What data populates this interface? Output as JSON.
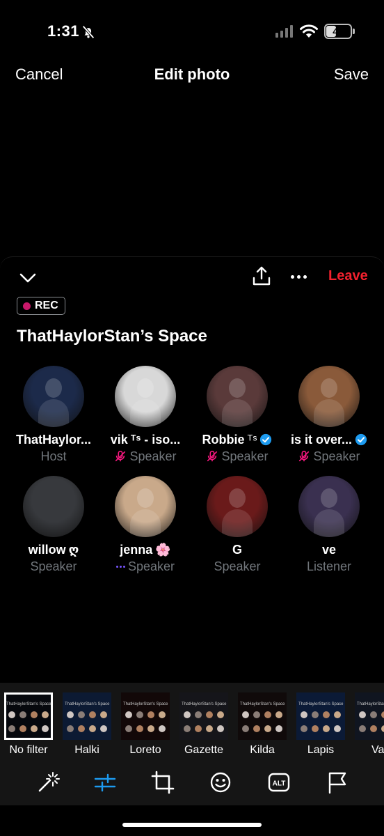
{
  "status_bar": {
    "time": "1:31",
    "battery": "42",
    "battery_level": 0.42
  },
  "nav": {
    "cancel": "Cancel",
    "title": "Edit photo",
    "save": "Save"
  },
  "space": {
    "leave": "Leave",
    "rec": "REC",
    "title": "ThatHaylorStan’s Space",
    "participants": [
      {
        "name": "ThatHaylor...",
        "role": "Host",
        "avatar_color": "#1c2a4a"
      },
      {
        "name": "vik",
        "name_suffix": "ᵀˢ - iso...",
        "role": "Speaker",
        "muted": true,
        "avatar_color": "#d8d8d8"
      },
      {
        "name": "Robbie",
        "name_suffix": "ᵀˢ",
        "role": "Speaker",
        "muted": true,
        "verified": true,
        "avatar_color": "#5a3a3a"
      },
      {
        "name": "is it over...",
        "role": "Speaker",
        "muted": true,
        "verified": true,
        "avatar_color": "#8a5a3a"
      },
      {
        "name": "willow",
        "name_suffix": "ღ",
        "role": "Speaker",
        "avatar_color": "#37393d"
      },
      {
        "name": "jenna",
        "name_suffix": "🌸",
        "role": "Speaker",
        "speaking": true,
        "avatar_color": "#c9a98a"
      },
      {
        "name": "G",
        "role": "Speaker",
        "avatar_color": "#6a1a1a"
      },
      {
        "name": "ve",
        "role": "Listener",
        "avatar_color": "#3a3050"
      }
    ]
  },
  "filters": [
    {
      "label": "No filter",
      "selected": true,
      "tint": "#06080d"
    },
    {
      "label": "Halki",
      "tint": "#0c1a33"
    },
    {
      "label": "Loreto",
      "tint": "#120808"
    },
    {
      "label": "Gazette",
      "tint": "#15151a"
    },
    {
      "label": "Kilda",
      "tint": "#100a0a"
    },
    {
      "label": "Lapis",
      "tint": "#0b1a36"
    },
    {
      "label": "Vai",
      "tint": "#101520"
    }
  ],
  "thumb_title": "ThatHaylorStan's Space",
  "tools": [
    "magic-wand-icon",
    "adjust-sliders-icon",
    "crop-icon",
    "sticker-icon",
    "alt-text-icon",
    "flag-icon"
  ],
  "tool_alt_label": "ALT",
  "colors": {
    "accent": "#1d9bf0",
    "leave": "#f4212e",
    "rec": "#c9186a",
    "muted": "#f91880",
    "secondary_text": "#71767b"
  }
}
